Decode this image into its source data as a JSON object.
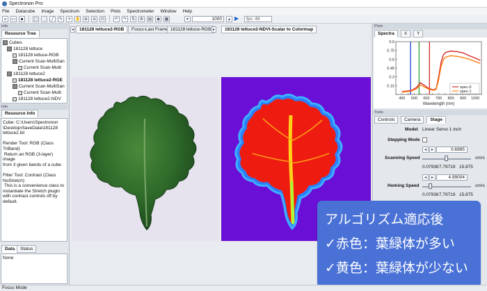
{
  "app": {
    "title": "Spectronon Pro"
  },
  "menu": [
    "File",
    "Datacube",
    "Image",
    "Spectrum",
    "Selection",
    "Plots",
    "Spectrometer",
    "Window",
    "Help"
  ],
  "toolbar": {
    "frame": "1000",
    "fps_placeholder": "fps: 49"
  },
  "left": {
    "resource_tree_label": "Resource Tree",
    "tree": [
      {
        "label": "Cubes",
        "level": 0
      },
      {
        "label": "181128 lettuce",
        "level": 1
      },
      {
        "label": "181128 lettuce-RGB",
        "level": 2
      },
      {
        "label": "Current Scan-MultiSan",
        "level": 2
      },
      {
        "label": "Current Scan-Multi",
        "level": 3
      },
      {
        "label": "181128 lettuce2",
        "level": 1
      },
      {
        "label": "181128 lettuce2-RGE",
        "level": 2
      },
      {
        "label": "Current Scan-MultiSan",
        "level": 2
      },
      {
        "label": "Current Scan-Multi",
        "level": 3
      },
      {
        "label": "181128 lettuce2-NDV",
        "level": 2
      },
      {
        "label": "181128 lettuce2-NDV",
        "level": 2
      }
    ],
    "resource_info_label": "Resource Info",
    "info_text": "Cube: C:\\Users\\Spectronon\n\\Desktop\\SaveData\\181128\nlettuce2.bil\n\nRender Tool: RGB (Class\nTriBand)\n Return an RGB (3-layer) image\nfrom 3 given bands of a cube\n\nFilter Tool: Contrast (Class\nNoStretch)\n This is a convenience class to\ninstantiate the Stretch plugin\nwith contrast controls off by\ndefault.",
    "data_tab": "Data",
    "status_tab": "Status",
    "data_value": "None"
  },
  "center": {
    "tabs": [
      "181128 lettuce2-RGB",
      "Focus-Last Frame",
      "181128 lettuce-RGB"
    ],
    "right_tab": "181128 lettuce2-NDVI-Scalar to Colormap"
  },
  "plot": {
    "tabs": [
      "Spectra",
      "X",
      "Y"
    ],
    "legend": [
      "spec-0",
      "spec-1"
    ]
  },
  "chart_data": {
    "type": "line",
    "xlabel": "Wavelength (nm)",
    "x_ticks": [
      400,
      450,
      500,
      550,
      600,
      650,
      700,
      750,
      800,
      850,
      900,
      950,
      1000,
      1050
    ],
    "xlim": [
      350,
      1050
    ],
    "ylim": [
      0,
      0.9
    ],
    "y_ticks": [
      0,
      0.15,
      0.3,
      0.45,
      0.6,
      0.75,
      0.9
    ],
    "x_tick_labels": [
      "400",
      "450",
      "500",
      "550",
      "600",
      "650",
      "700",
      "750",
      "800",
      "850",
      "900",
      "950",
      "1000",
      "1050"
    ],
    "y_tick_labels": [
      "",
      "0.15",
      "0.3",
      "0.45",
      "0.6",
      "0.75",
      "0.9"
    ],
    "series": [
      {
        "name": "spec-0",
        "color": "#d62728",
        "x": [
          400,
          450,
          480,
          520,
          550,
          580,
          620,
          660,
          680,
          700,
          720,
          740,
          760,
          800,
          850,
          900,
          950,
          1000,
          1040
        ],
        "y": [
          0.05,
          0.06,
          0.07,
          0.12,
          0.2,
          0.16,
          0.1,
          0.08,
          0.1,
          0.3,
          0.55,
          0.68,
          0.72,
          0.74,
          0.73,
          0.71,
          0.66,
          0.62,
          0.58
        ]
      },
      {
        "name": "spec-1",
        "color": "#ff7f0e",
        "x": [
          400,
          450,
          480,
          520,
          550,
          580,
          620,
          660,
          680,
          700,
          720,
          740,
          760,
          800,
          850,
          900,
          950,
          1000,
          1040
        ],
        "y": [
          0.04,
          0.05,
          0.06,
          0.1,
          0.16,
          0.13,
          0.09,
          0.07,
          0.09,
          0.25,
          0.48,
          0.6,
          0.64,
          0.66,
          0.65,
          0.63,
          0.6,
          0.56,
          0.53
        ]
      }
    ],
    "band_markers": [
      {
        "x": 470,
        "color": "#1f3fd6"
      },
      {
        "x": 540,
        "color": "#2ca02c"
      },
      {
        "x": 625,
        "color": "#d62728"
      }
    ]
  },
  "tools": {
    "tabs": [
      "Controls",
      "Camera",
      "Stage"
    ],
    "model_label": "Model",
    "model_value": "Linear Servo 1 inch",
    "stepping_label": "Stepping Mode",
    "scanning_label": "Scanning Speed",
    "scanning_value": "0.6985",
    "scanning_unit": "cm/s",
    "scanning_range": [
      "0.07938",
      "7.79719",
      "15.875"
    ],
    "scanning_level": 0.49,
    "homing_label": "Homing Speed",
    "homing_value": "4.99004",
    "homing_unit": "cm/s",
    "homing_range": [
      "0.07938",
      "7.79719",
      "15.875"
    ],
    "homing_level": 0.15
  },
  "overlay": {
    "line1": "アルゴリズム適応後",
    "line2": "✓赤色：葉緑体が多い",
    "line3": "✓黄色：葉緑体が少ない"
  },
  "status": {
    "text": "Focus Mode"
  },
  "colors": {
    "ndvi_bg": "#6a0fd6",
    "overlay_bg": "#4a72d6",
    "accent": "#1a63c9"
  }
}
